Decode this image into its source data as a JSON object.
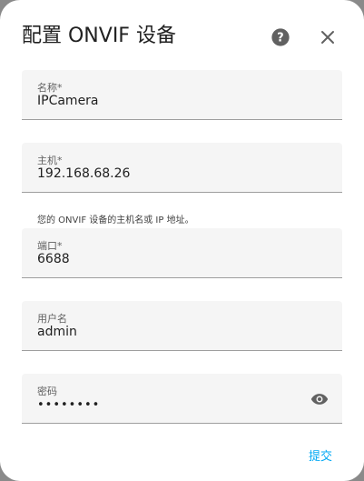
{
  "dialog": {
    "title": "配置 ONVIF 设备",
    "help_icon": "help-circle-icon",
    "close_icon": "close-icon"
  },
  "fields": [
    {
      "label": "名称*",
      "value": "IPCamera"
    },
    {
      "label": "主机*",
      "value": "192.168.68.26",
      "helper": "您的 ONVIF 设备的主机名或 IP 地址。"
    },
    {
      "label": "端口*",
      "value": "6688"
    },
    {
      "label": "用户名",
      "value": "admin"
    },
    {
      "label": "密码",
      "value": "••••••••",
      "toggle_icon": "eye-icon"
    }
  ],
  "actions": {
    "submit_label": "提交"
  },
  "colors": {
    "accent": "#03a9f4",
    "field_bg": "#f5f5f5",
    "icon": "#616161"
  }
}
